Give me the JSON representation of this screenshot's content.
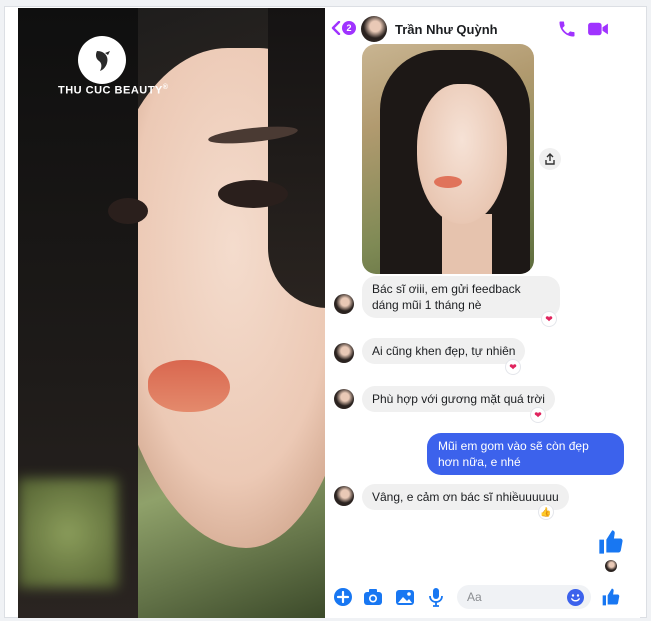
{
  "brand": {
    "name": "THU CUC BEAUTY",
    "registered_mark": "®"
  },
  "header": {
    "back_count": "2",
    "contact_name": "Trần Như Quỳnh",
    "icons": [
      "chevron-left-icon",
      "phone-icon",
      "video-camera-icon"
    ]
  },
  "messages": [
    {
      "from": "contact",
      "text": "Bác sĩ ơiii, em gửi feedback dáng mũi 1 tháng nè",
      "reaction": "❤"
    },
    {
      "from": "contact",
      "text": "Ai cũng khen đẹp, tự nhiên",
      "reaction": "❤"
    },
    {
      "from": "contact",
      "text": "Phù hợp với gương mặt quá trời",
      "reaction": "❤"
    },
    {
      "from": "me",
      "text": "Mũi em gom vào sẽ còn đẹp hơn nữa, e nhé"
    },
    {
      "from": "contact",
      "text": "Vâng, e cảm ơn bác sĩ nhiềuuuuuu",
      "reaction": "👍"
    }
  ],
  "composer": {
    "placeholder": "Aa",
    "icons": [
      "plus-icon",
      "camera-icon",
      "image-icon",
      "microphone-icon",
      "emoji-icon",
      "thumbs-up-icon"
    ]
  },
  "colors": {
    "accent": "#a033ff",
    "outgoing_bubble": "#3c62ec",
    "incoming_bubble": "#f0f0f0",
    "like": "#1877f2"
  }
}
